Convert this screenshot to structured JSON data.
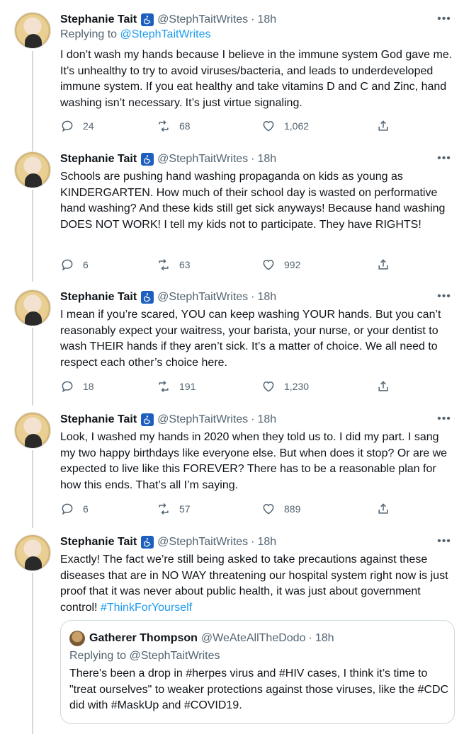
{
  "tweets": [
    {
      "name": "Stephanie Tait",
      "handle": "@StephTaitWrites",
      "dot": "·",
      "time": "18h",
      "more": "•••",
      "reply_prefix": "Replying to",
      "reply_handle": "@StephTaitWrites",
      "text": "I don’t wash my hands because I believe in the immune system God gave me. It’s unhealthy to try to avoid viruses/bacteria, and leads to underdeveloped immune system. If you eat healthy and take vitamins D and C and Zinc, hand washing isn’t necessary. It’s just virtue signaling.",
      "replies": "24",
      "retweets": "68",
      "likes": "1,062"
    },
    {
      "name": "Stephanie Tait",
      "handle": "@StephTaitWrites",
      "dot": "·",
      "time": "18h",
      "more": "•••",
      "text": "Schools are pushing hand washing propaganda on kids as young as KINDERGARTEN. How much of their school day is wasted on performative hand washing? And these kids still get sick anyways! Because hand washing DOES NOT WORK! I tell my kids not to participate. They have RIGHTS!",
      "replies": "6",
      "retweets": "63",
      "likes": "992"
    },
    {
      "name": "Stephanie Tait",
      "handle": "@StephTaitWrites",
      "dot": "·",
      "time": "18h",
      "more": "•••",
      "text": "I mean if you’re scared, YOU can keep washing YOUR hands. But you can’t reasonably expect your waitress, your barista, your nurse, or your dentist to wash THEIR hands if they aren’t sick. It’s a matter of choice. We all need to respect each other’s choice here.",
      "replies": "18",
      "retweets": "191",
      "likes": "1,230"
    },
    {
      "name": "Stephanie Tait",
      "handle": "@StephTaitWrites",
      "dot": "·",
      "time": "18h",
      "more": "•••",
      "text": "Look, I washed my hands in 2020 when they told us to. I did my part. I sang my two happy birthdays like everyone else. But when does it stop? Or are we expected to live like this FOREVER? There has to be a reasonable plan for how this ends. That’s all I’m saying.",
      "replies": "6",
      "retweets": "57",
      "likes": "889"
    },
    {
      "name": "Stephanie Tait",
      "handle": "@StephTaitWrites",
      "dot": "·",
      "time": "18h",
      "more": "•••",
      "text": "Exactly! The fact we’re still being asked to take precautions against these diseases that are in NO WAY threatening our hospital system right now is just proof that it was never about public health, it was just about government control!",
      "hashtag": "#ThinkForYourself"
    }
  ],
  "quote": {
    "name": "Gatherer Thompson",
    "handle": "@WeAteAllTheDodo",
    "dot": "·",
    "time": "18h",
    "reply_text": "Replying to @StephTaitWrites",
    "text": "There’s been a drop in #herpes virus and #HIV cases, I think it’s time to \"treat ourselves\" to weaker protections against those viruses, like the #CDC did with #MaskUp and #COVID19."
  }
}
